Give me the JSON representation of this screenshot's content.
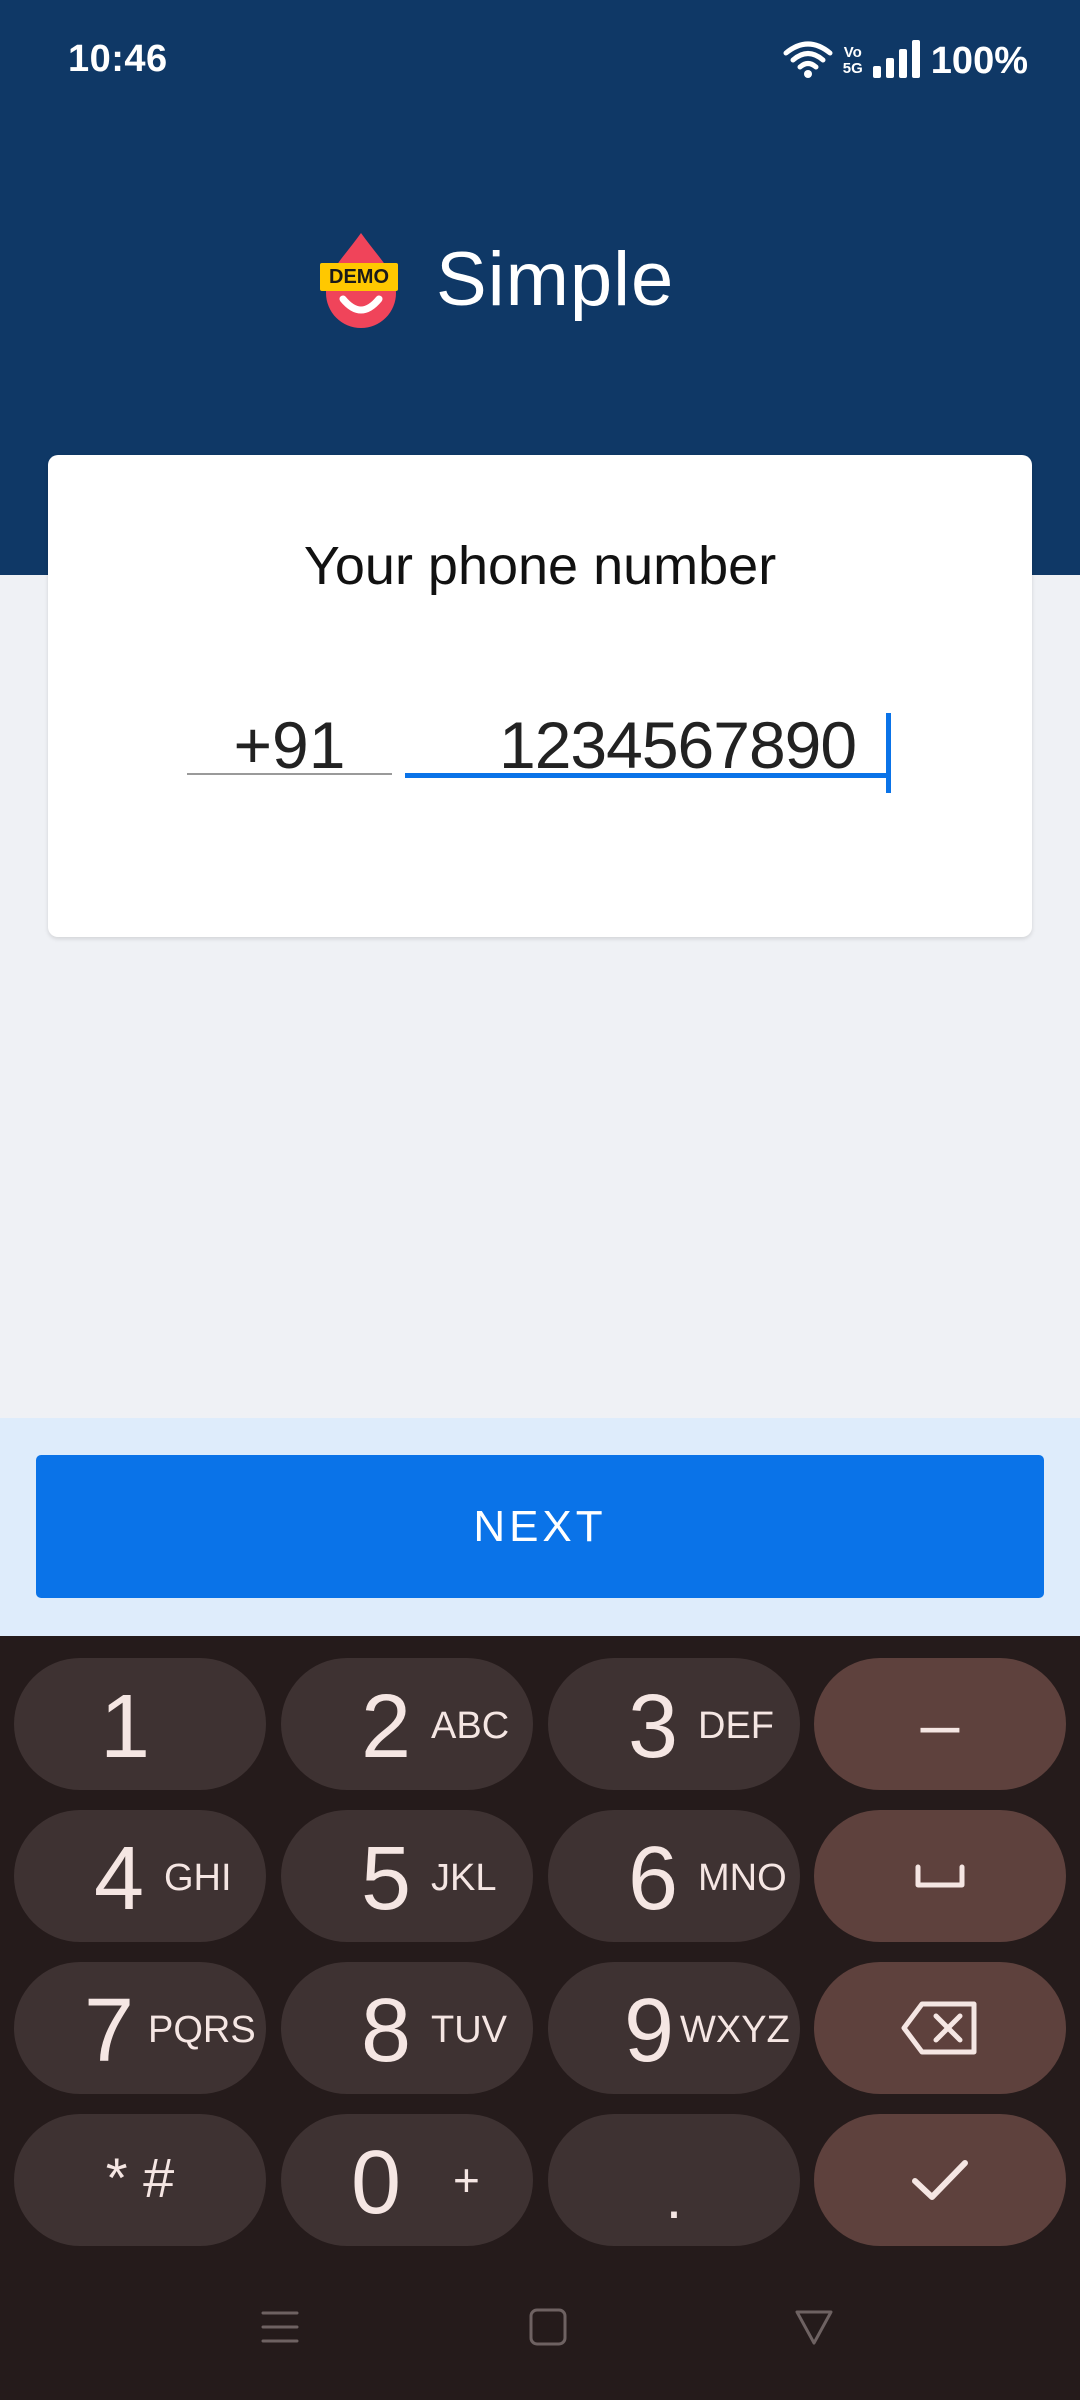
{
  "status_bar": {
    "time": "10:46",
    "volte": "Vo 5G",
    "battery": "100%"
  },
  "header": {
    "badge": "DEMO",
    "app_name": "Simple"
  },
  "card": {
    "title": "Your phone number",
    "country_code": "+91",
    "phone_number": "1234567890"
  },
  "next_label": "NEXT",
  "keyboard": {
    "keys": [
      {
        "num": "1",
        "sub": ""
      },
      {
        "num": "2",
        "sub": "ABC"
      },
      {
        "num": "3",
        "sub": "DEF"
      },
      {
        "num": "4",
        "sub": "GHI"
      },
      {
        "num": "5",
        "sub": "JKL"
      },
      {
        "num": "6",
        "sub": "MNO"
      },
      {
        "num": "7",
        "sub": "PQRS"
      },
      {
        "num": "8",
        "sub": "TUV"
      },
      {
        "num": "9",
        "sub": "WXYZ"
      },
      {
        "num": "0",
        "sub": "+"
      }
    ],
    "symbols_label": "* #",
    "period_label": ".",
    "minus_label": "–"
  },
  "colors": {
    "header_bg": "#0f3866",
    "accent": "#0a73e8",
    "badge": "#ffc800",
    "drop": "#f0445a"
  }
}
